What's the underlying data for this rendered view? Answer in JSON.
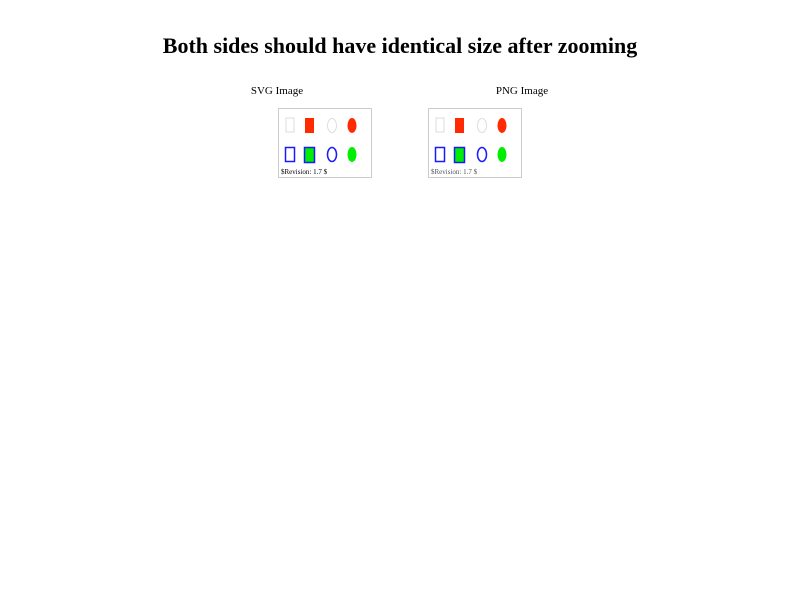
{
  "title": "Both sides should have identical size after zooming",
  "svg_panel": {
    "label": "SVG Image",
    "revision_text": "$Revision: 1.7 $"
  },
  "png_panel": {
    "label": "PNG Image",
    "revision_text": "$Revision: 1.7 $"
  },
  "colors": {
    "red": "#ff2a00",
    "blue": "#1a1aff",
    "green": "#00ee00",
    "light_gray": "#dddddd",
    "frame_border": "#cccccc"
  },
  "icons": [
    "outline-gray-rect-icon",
    "filled-red-rect-icon",
    "outline-gray-ellipse-icon",
    "filled-red-ellipse-icon",
    "outline-blue-rect-icon",
    "green-rect-blue-stroke-icon",
    "outline-blue-ellipse-icon",
    "filled-green-ellipse-icon"
  ]
}
